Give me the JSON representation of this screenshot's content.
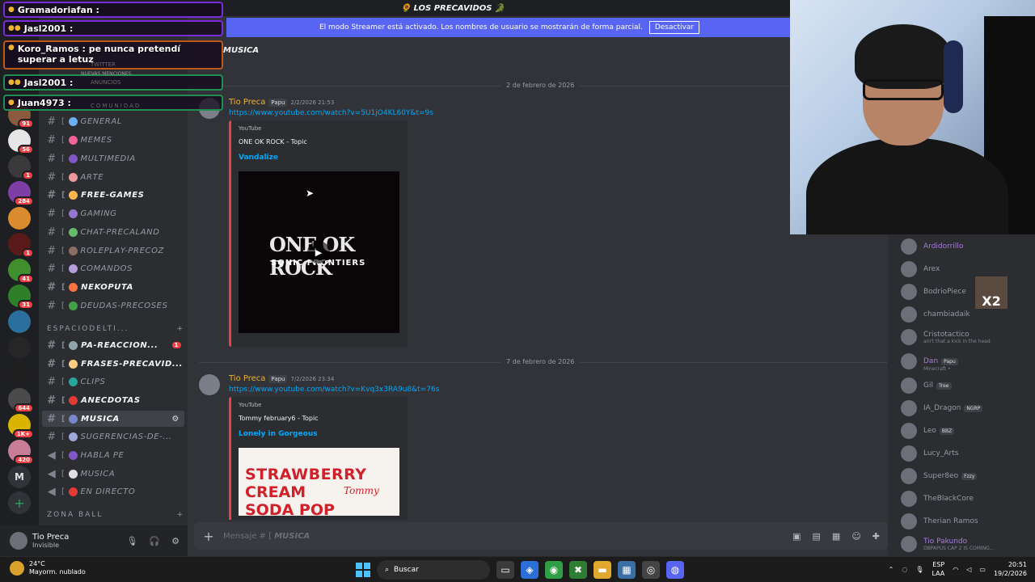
{
  "window": {
    "title": "🌻 LOS PRECAVIDOS 🐊"
  },
  "streamer_banner": {
    "text": "El modo Streamer está activado. Los nombres de usuario se mostrarán de forma parcial.",
    "button": "Desactivar"
  },
  "servers": {
    "badges": [
      "91",
      "56",
      "1",
      "284",
      "1",
      "41",
      "31",
      "644",
      "1K+",
      "420"
    ],
    "letter": "M",
    "add_icon": "+"
  },
  "channels": {
    "items": [
      {
        "label": "GENERAL",
        "color": "#6ab0f3"
      },
      {
        "label": "MEMES",
        "color": "#f06292"
      },
      {
        "label": "MULTIMEDIA",
        "color": "#7e57c2"
      },
      {
        "label": "ARTE",
        "color": "#ef9a9a"
      },
      {
        "label": "FREE-GAMES",
        "color": "#ffb74d"
      },
      {
        "label": "GAMING",
        "color": "#9575cd"
      },
      {
        "label": "CHAT-PRECALAND",
        "color": "#66bb6a"
      },
      {
        "label": "ROLEPLAY-PRECOZ",
        "color": "#8d6e63"
      },
      {
        "label": "COMANDOS",
        "color": "#b39ddb"
      },
      {
        "label": "NEKOPUTA",
        "color": "#ff7043"
      },
      {
        "label": "DEUDAS-PRECOSES",
        "color": "#43a047"
      },
      {
        "label": "PA-REACCION...",
        "color": "#90a4ae",
        "count": "1"
      },
      {
        "label": "FRASES-PRECAVID...",
        "color": "#ffcc80"
      },
      {
        "label": "CLIPS",
        "color": "#26a69a"
      },
      {
        "label": "ANECDOTAS",
        "color": "#e53935"
      },
      {
        "label": "MUSICA",
        "color": "#7986cb"
      },
      {
        "label": "SUGERENCIAS-DE-...",
        "color": "#9fa8da"
      },
      {
        "label": "HABLA PE",
        "color": "#7e57c2"
      },
      {
        "label": "MUSICA",
        "color": "#e0e0e0"
      },
      {
        "label": "EN DIRECTO",
        "color": "#e53935"
      }
    ],
    "category1": "ESPACIODELTI...",
    "category2": "ZONA BALL",
    "category_plus": "+"
  },
  "user": {
    "name": "Tio Preca",
    "status": "Invisible"
  },
  "chat": {
    "channel": "MUSICA",
    "date1": "2 de febrero de 2026",
    "date2": "7 de febrero de 2026",
    "messages": [
      {
        "author": "Tio Preca",
        "tag": "Papu",
        "time": "2/2/2026 21:53",
        "link": "https://www.youtube.com/watch?v=5U1jO4KL60Y&t=9s",
        "provider": "YouTube",
        "embed_author": "ONE OK ROCK - Topic",
        "embed_title": "Vandalize",
        "art_line1": "ONE OK ROCK",
        "art_line2": "SONIC FRONTIERS"
      },
      {
        "author": "Tio Preca",
        "tag": "Papu",
        "time": "7/2/2026 23:34",
        "link": "https://www.youtube.com/watch?v=Kvq3x3RA9u8&t=76s",
        "provider": "YouTube",
        "embed_author": "Tommy february6 - Topic",
        "embed_title": "Lonely in Gorgeous",
        "art_line1": "STRAWBERRY",
        "art_line2": "CREAM",
        "art_line3": "SODA POP",
        "art_script": "Tommy"
      }
    ],
    "composer_prefix": "Mensaje #",
    "composer_channel": "MUSICA"
  },
  "members": [
    {
      "name": "Ardidorrillo",
      "color": "#a77bdc"
    },
    {
      "name": "Arex",
      "color": "#949ba4"
    },
    {
      "name": "BodrioPiece",
      "color": "#949ba4"
    },
    {
      "name": "chambiadaik",
      "color": "#949ba4"
    },
    {
      "name": "Cristotactico",
      "color": "#949ba4",
      "sub": "ain't that a kick in the head"
    },
    {
      "name": "Dan",
      "color": "#a77bdc",
      "tag": "Papu",
      "sub": "Minecraft •"
    },
    {
      "name": "Gil",
      "color": "#949ba4",
      "tag": "Tree"
    },
    {
      "name": "IA_Dragon",
      "color": "#949ba4",
      "tag": "NGRP"
    },
    {
      "name": "Leo",
      "color": "#949ba4",
      "tag": "BBZ"
    },
    {
      "name": "Lucy_Arts",
      "color": "#949ba4"
    },
    {
      "name": "Super8eo",
      "color": "#949ba4",
      "tag": "Fzzy"
    },
    {
      "name": "TheBlackCore",
      "color": "#949ba4"
    },
    {
      "name": "Therian Ramos",
      "color": "#949ba4"
    },
    {
      "name": "Tio Pakundo",
      "color": "#a77bdc",
      "sub": "DBPAPUS CAP 2 IS COMING..."
    }
  ],
  "member_overlay": "X2",
  "overlay": [
    {
      "text": "Gramadoriafan :"
    },
    {
      "text": "Jasl2001 :"
    },
    {
      "text": "Koro_Ramos : pe nunca pretendí superar a letuz"
    },
    {
      "text": "Jasl2001 :"
    },
    {
      "text": "Juan4973 :"
    }
  ],
  "overlay_faded": [
    "NUEVAS MENCIONES",
    "TWITTER",
    "ANUNCIOS",
    "COMUNIDAD"
  ],
  "taskbar": {
    "temp": "24°C",
    "weather": "Mayorm. nublado",
    "search": "Buscar",
    "lang1": "ESP",
    "lang2": "LAA",
    "time": "20:51",
    "date": "19/2/2026"
  }
}
